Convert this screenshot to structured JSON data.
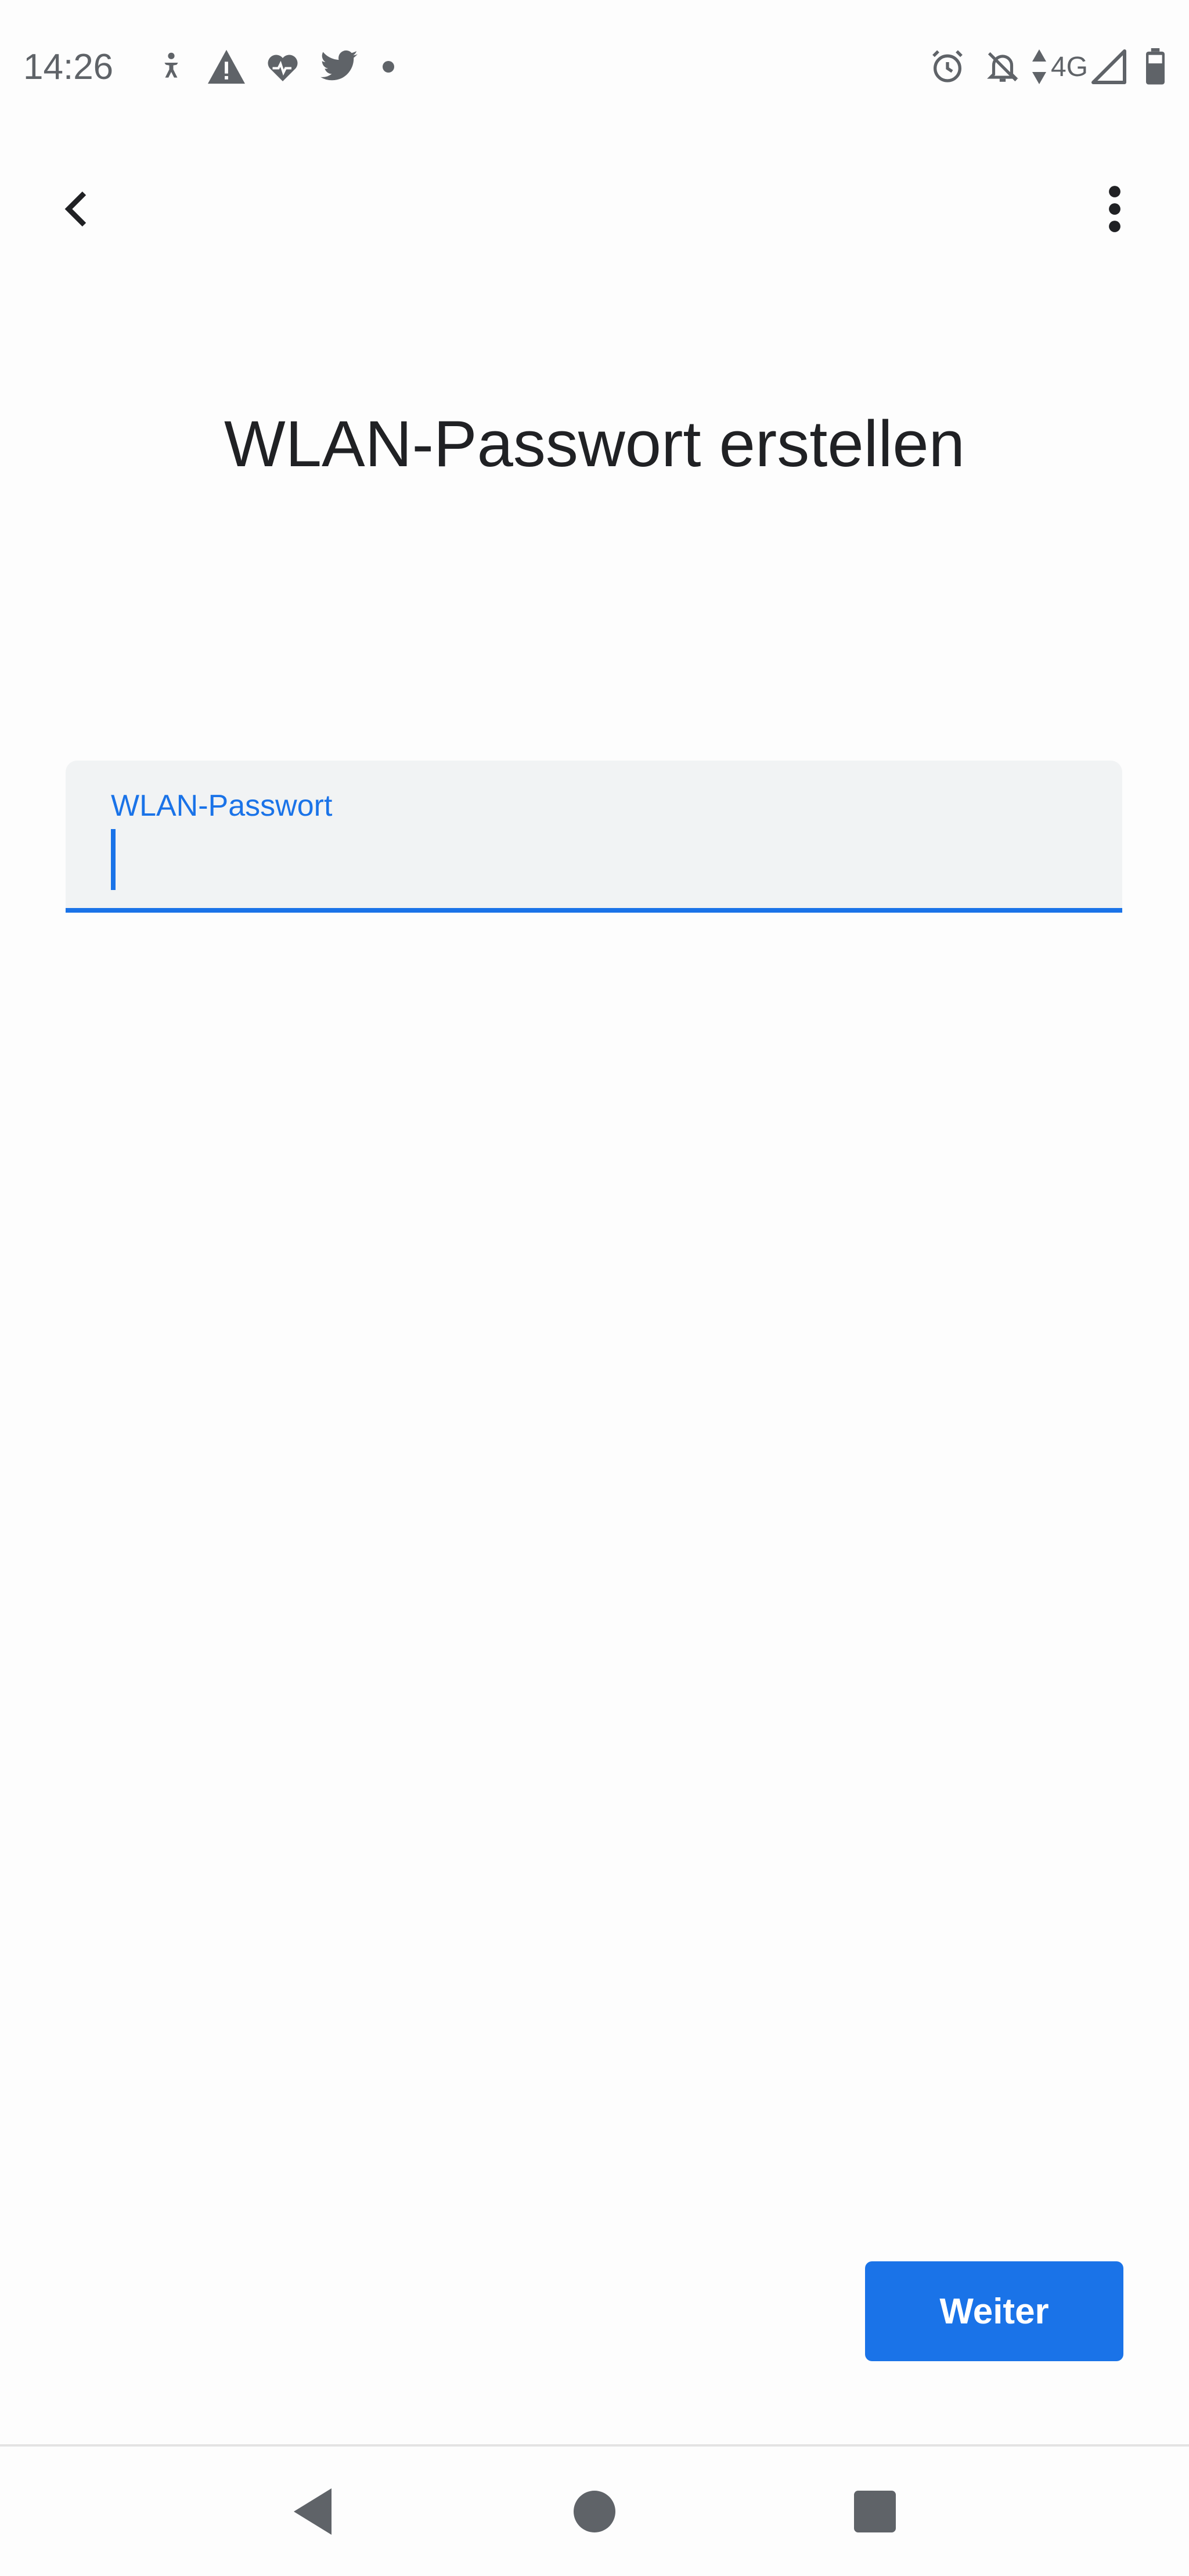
{
  "status_bar": {
    "time": "14:26",
    "network": "4G",
    "left_icons": [
      "accessibility-icon",
      "warning-icon",
      "health-icon",
      "twitter-icon",
      "notification-dot-icon"
    ],
    "right_icons": [
      "alarm-icon",
      "notifications-off-icon",
      "data-arrows-icon",
      "signal-icon",
      "battery-icon"
    ]
  },
  "app_bar": {
    "back_icon": "chevron-left-icon",
    "more_icon": "more-vert-icon"
  },
  "main": {
    "title": "WLAN-Passwort erstellen",
    "password_field": {
      "label": "WLAN-Passwort",
      "value": ""
    },
    "next_button": "Weiter"
  },
  "nav_bar": {
    "icons": [
      "back-triangle-icon",
      "home-circle-icon",
      "recents-square-icon"
    ]
  },
  "colors": {
    "accent": "#1a73e8",
    "field_bg": "#f1f3f4",
    "text": "#202124",
    "icon_gray": "#5f6368"
  }
}
